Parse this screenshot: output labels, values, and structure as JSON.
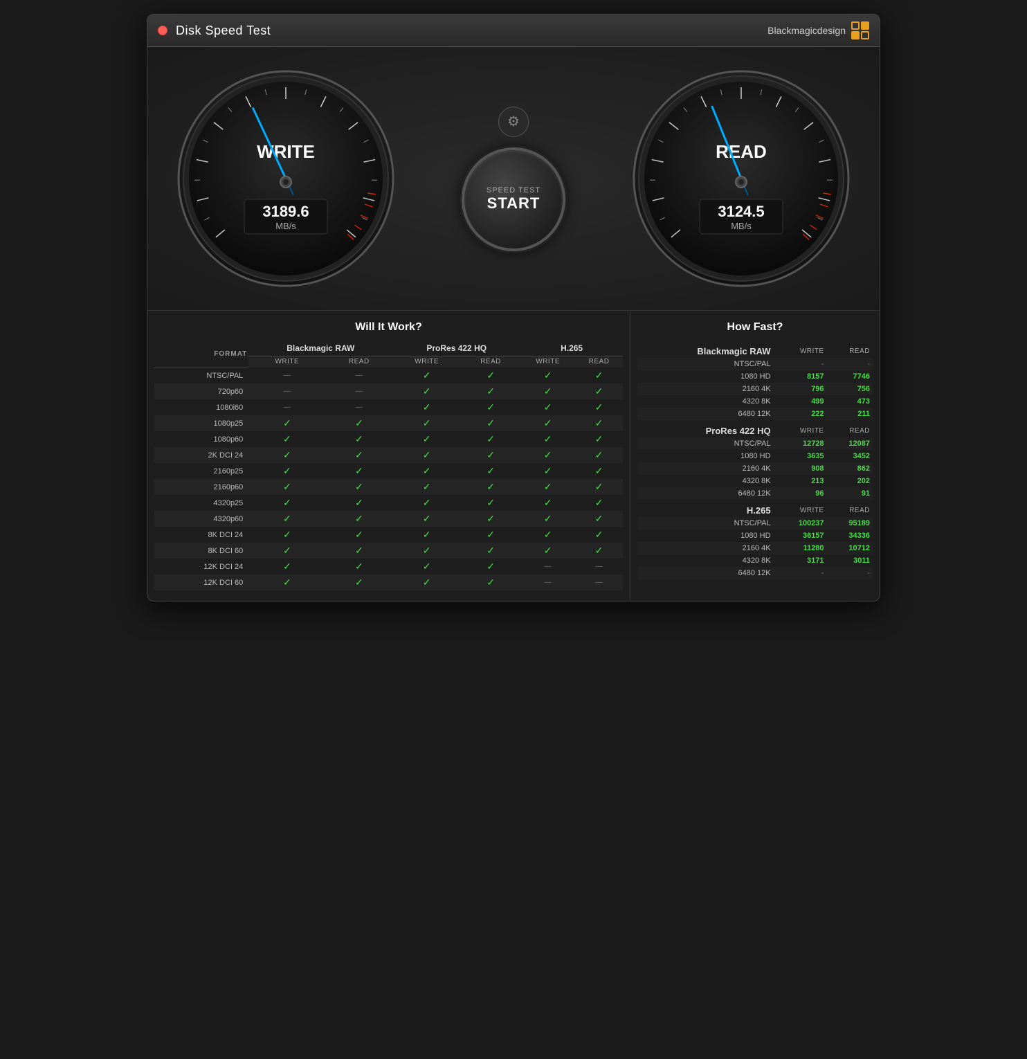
{
  "window": {
    "title": "Disk Speed Test",
    "brand": "Blackmagicdesign"
  },
  "gauges": {
    "write": {
      "label": "WRITE",
      "value": "3189.6",
      "unit": "MB/s",
      "needle_angle": -20
    },
    "read": {
      "label": "READ",
      "value": "3124.5",
      "unit": "MB/s",
      "needle_angle": -20
    },
    "start_btn": {
      "sub": "SPEED TEST",
      "main": "START"
    }
  },
  "will_it_work": {
    "title": "Will It Work?",
    "col_groups": [
      "Blackmagic RAW",
      "ProRes 422 HQ",
      "H.265"
    ],
    "col_sub": [
      "WRITE",
      "READ",
      "WRITE",
      "READ",
      "WRITE",
      "READ"
    ],
    "format_label": "FORMAT",
    "rows": [
      {
        "label": "NTSC/PAL",
        "braw_w": "–",
        "braw_r": "–",
        "prores_w": "✓",
        "prores_r": "✓",
        "h265_w": "✓",
        "h265_r": "✓"
      },
      {
        "label": "720p60",
        "braw_w": "–",
        "braw_r": "–",
        "prores_w": "✓",
        "prores_r": "✓",
        "h265_w": "✓",
        "h265_r": "✓"
      },
      {
        "label": "1080i60",
        "braw_w": "–",
        "braw_r": "–",
        "prores_w": "✓",
        "prores_r": "✓",
        "h265_w": "✓",
        "h265_r": "✓"
      },
      {
        "label": "1080p25",
        "braw_w": "✓",
        "braw_r": "✓",
        "prores_w": "✓",
        "prores_r": "✓",
        "h265_w": "✓",
        "h265_r": "✓"
      },
      {
        "label": "1080p60",
        "braw_w": "✓",
        "braw_r": "✓",
        "prores_w": "✓",
        "prores_r": "✓",
        "h265_w": "✓",
        "h265_r": "✓"
      },
      {
        "label": "2K DCI 24",
        "braw_w": "✓",
        "braw_r": "✓",
        "prores_w": "✓",
        "prores_r": "✓",
        "h265_w": "✓",
        "h265_r": "✓"
      },
      {
        "label": "2160p25",
        "braw_w": "✓",
        "braw_r": "✓",
        "prores_w": "✓",
        "prores_r": "✓",
        "h265_w": "✓",
        "h265_r": "✓"
      },
      {
        "label": "2160p60",
        "braw_w": "✓",
        "braw_r": "✓",
        "prores_w": "✓",
        "prores_r": "✓",
        "h265_w": "✓",
        "h265_r": "✓"
      },
      {
        "label": "4320p25",
        "braw_w": "✓",
        "braw_r": "✓",
        "prores_w": "✓",
        "prores_r": "✓",
        "h265_w": "✓",
        "h265_r": "✓"
      },
      {
        "label": "4320p60",
        "braw_w": "✓",
        "braw_r": "✓",
        "prores_w": "✓",
        "prores_r": "✓",
        "h265_w": "✓",
        "h265_r": "✓"
      },
      {
        "label": "8K DCI 24",
        "braw_w": "✓",
        "braw_r": "✓",
        "prores_w": "✓",
        "prores_r": "✓",
        "h265_w": "✓",
        "h265_r": "✓"
      },
      {
        "label": "8K DCI 60",
        "braw_w": "✓",
        "braw_r": "✓",
        "prores_w": "✓",
        "prores_r": "✓",
        "h265_w": "✓",
        "h265_r": "✓"
      },
      {
        "label": "12K DCI 24",
        "braw_w": "✓",
        "braw_r": "✓",
        "prores_w": "✓",
        "prores_r": "✓",
        "h265_w": "–",
        "h265_r": "–"
      },
      {
        "label": "12K DCI 60",
        "braw_w": "✓",
        "braw_r": "✓",
        "prores_w": "✓",
        "prores_r": "✓",
        "h265_w": "–",
        "h265_r": "–"
      }
    ]
  },
  "how_fast": {
    "title": "How Fast?",
    "sections": [
      {
        "name": "Blackmagic RAW",
        "rows": [
          {
            "label": "NTSC/PAL",
            "write": "-",
            "read": "-"
          },
          {
            "label": "1080 HD",
            "write": "8157",
            "read": "7746"
          },
          {
            "label": "2160 4K",
            "write": "796",
            "read": "756"
          },
          {
            "label": "4320 8K",
            "write": "499",
            "read": "473"
          },
          {
            "label": "6480 12K",
            "write": "222",
            "read": "211"
          }
        ]
      },
      {
        "name": "ProRes 422 HQ",
        "rows": [
          {
            "label": "NTSC/PAL",
            "write": "12728",
            "read": "12087"
          },
          {
            "label": "1080 HD",
            "write": "3635",
            "read": "3452"
          },
          {
            "label": "2160 4K",
            "write": "908",
            "read": "862"
          },
          {
            "label": "4320 8K",
            "write": "213",
            "read": "202"
          },
          {
            "label": "6480 12K",
            "write": "96",
            "read": "91"
          }
        ]
      },
      {
        "name": "H.265",
        "rows": [
          {
            "label": "NTSC/PAL",
            "write": "100237",
            "read": "95189"
          },
          {
            "label": "1080 HD",
            "write": "36157",
            "read": "34336"
          },
          {
            "label": "2160 4K",
            "write": "11280",
            "read": "10712"
          },
          {
            "label": "4320 8K",
            "write": "3171",
            "read": "3011"
          },
          {
            "label": "6480 12K",
            "write": "-",
            "read": "-"
          }
        ]
      }
    ]
  }
}
